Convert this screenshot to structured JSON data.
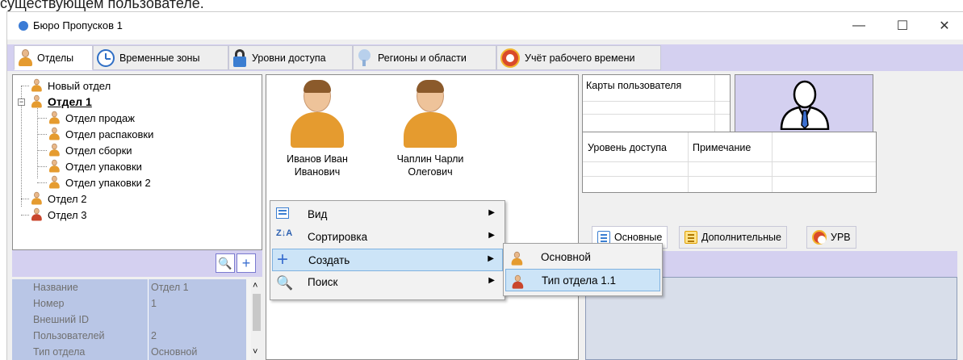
{
  "caption": "существующем пользователе.",
  "window": {
    "title": "Бюро Пропусков 1",
    "controls": {
      "minimize": "—",
      "maximize": "☐",
      "close": "✕"
    }
  },
  "tabs": [
    {
      "label": "Отделы",
      "icon": "person-icon"
    },
    {
      "label": "Временные зоны",
      "icon": "clock-icon"
    },
    {
      "label": "Уровни доступа",
      "icon": "lock-icon"
    },
    {
      "label": "Регионы и области",
      "icon": "region-icon"
    },
    {
      "label": "Учёт рабочего времени",
      "icon": "urv-icon"
    }
  ],
  "tree": {
    "items": [
      {
        "label": "Новый отдел"
      },
      {
        "label": "Отдел 1"
      },
      {
        "label": "Отдел продаж"
      },
      {
        "label": "Отдел распаковки"
      },
      {
        "label": "Отдел сборки"
      },
      {
        "label": "Отдел упаковки"
      },
      {
        "label": "Отдел упаковки 2"
      },
      {
        "label": "Отдел 2"
      },
      {
        "label": "Отдел 3"
      }
    ],
    "expander": "−"
  },
  "search_strip": {
    "search_glyph": "🔍",
    "add_glyph": "+"
  },
  "properties": [
    {
      "key": "Название",
      "value": "Отдел 1"
    },
    {
      "key": "Номер",
      "value": "1"
    },
    {
      "key": "Внешний ID",
      "value": ""
    },
    {
      "key": "Пользователей",
      "value": "2"
    },
    {
      "key": "Тип отдела",
      "value": "Основной"
    }
  ],
  "scroll": {
    "up": "˄",
    "down": "˅"
  },
  "users": [
    {
      "name": "Иванов Иван",
      "name2": "Иванович"
    },
    {
      "name": "Чаплин Чарли",
      "name2": "Олегович"
    }
  ],
  "cards": {
    "header": "Карты пользователя"
  },
  "access": {
    "col1": "Уровень доступа",
    "col2": "Примечание"
  },
  "right_tabs": [
    {
      "label": "Основные"
    },
    {
      "label": "Дополнительные"
    },
    {
      "label": "УРВ"
    }
  ],
  "context_menu": {
    "items": [
      {
        "label": "Вид",
        "arrow": "▶"
      },
      {
        "label": "Сортировка",
        "arrow": "▶"
      },
      {
        "label": "Создать",
        "arrow": "▶"
      },
      {
        "label": "Поиск",
        "arrow": "▶"
      }
    ],
    "sort_glyph": "Z↓A",
    "plus_glyph": "+",
    "search_glyph": "🔍"
  },
  "submenu": {
    "items": [
      {
        "label": "Основной"
      },
      {
        "label": "Тип отдела 1.1"
      }
    ]
  },
  "colors": {
    "accent_lavender": "#d4d0f0",
    "highlight": "#cce4f7",
    "person_orange": "#e59b2f"
  }
}
